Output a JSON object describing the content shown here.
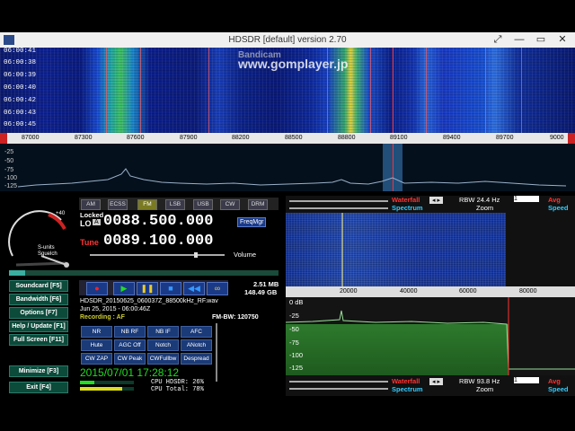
{
  "window": {
    "title": "HDSDR  [default]  version 2.70",
    "minimize": "—",
    "restore": "▭",
    "close": "✕",
    "expand": "⤢"
  },
  "watermark": {
    "line1": "Bandicam",
    "line2": "www.gomplayer.jp"
  },
  "waterfall_times": [
    "06:00:41",
    "06:00:38",
    "06:00:39",
    "06:00:40",
    "06:00:42",
    "06:00:43",
    "06:00:45"
  ],
  "main_scale": [
    "87000",
    "87300",
    "87600",
    "87900",
    "88200",
    "88500",
    "88800",
    "89100",
    "89400",
    "89700",
    "9000"
  ],
  "spectrum_scale": [
    "-25",
    "-50",
    "-75",
    "-100",
    "-125"
  ],
  "modes": [
    {
      "label": "AM",
      "selected": false
    },
    {
      "label": "ECSS",
      "selected": false
    },
    {
      "label": "FM",
      "selected": true
    },
    {
      "label": "LSB",
      "selected": false
    },
    {
      "label": "USB",
      "selected": false
    },
    {
      "label": "CW",
      "selected": false
    },
    {
      "label": "DRM",
      "selected": false
    }
  ],
  "lo": {
    "locked_label": "Locked",
    "lo_label": "LO",
    "a_label": "A",
    "value": "0088.500.000"
  },
  "tune": {
    "label": "Tune",
    "value": "0089.100.000"
  },
  "freqmgr": "FreqMgr",
  "volume": "Volume",
  "squelch": {
    "smeter": "S-units",
    "squelch": "Squelch",
    "plus": "+40"
  },
  "side_buttons": [
    {
      "label": "Soundcard  [F5]",
      "name": "soundcard-button"
    },
    {
      "label": "Bandwidth  [F6]",
      "name": "bandwidth-button"
    },
    {
      "label": "Options  [F7]",
      "name": "options-button"
    },
    {
      "label": "Help / Update  [F1]",
      "name": "help-button"
    },
    {
      "label": "Full Screen  [F11]",
      "name": "fullscreen-button"
    },
    {
      "label": "Minimize  [F3]",
      "name": "minimize-button"
    },
    {
      "label": "Exit  [F4]",
      "name": "exit-button"
    }
  ],
  "recording": {
    "size": "2.51 MB",
    "free": "148.49 GB",
    "filename": "HDSDR_20150625_060037Z_88500kHz_RF.wav",
    "date": "Jun 25, 2015 - 06:00:46Z",
    "status": "Recording : AF"
  },
  "fm_bw": "FM-BW: 120750",
  "fx_row1": [
    "NR",
    "NB RF",
    "NB IF",
    "AFC"
  ],
  "fx_row2": [
    "Hute",
    "AGC Off",
    "Notch",
    "ANotch"
  ],
  "fx_row3": [
    "CW ZAP",
    "CW Peak",
    "CWFullbw",
    "Despread"
  ],
  "clock": "2015/07/01 17:28:12",
  "cpu": {
    "hdsdr": "CPU HDSDR: 26%",
    "total": "CPU Total: 78%",
    "hdsdr_pct": 26,
    "total_pct": 78
  },
  "right_top": {
    "waterfall": "Waterfall",
    "spectrum": "Spectrum",
    "rbw": "RBW 24.4 Hz",
    "rbw_sel": "1",
    "zoom": "Zoom",
    "avg": "Avg",
    "speed": "Speed"
  },
  "right_bottom": {
    "waterfall": "Waterfall",
    "spectrum": "Spectrum",
    "rbw": "RBW 93.8 Hz",
    "rbw_sel": "1",
    "zoom": "Zoom",
    "avg": "Avg",
    "speed": "Speed"
  },
  "right_scale": [
    "20000",
    "40000",
    "60000",
    "80000"
  ],
  "right_db": [
    "0 dB",
    "-25",
    "-50",
    "-75",
    "-100",
    "-125"
  ]
}
